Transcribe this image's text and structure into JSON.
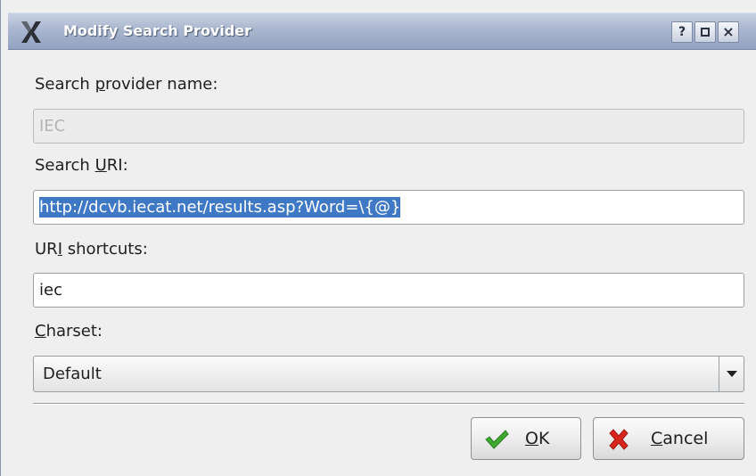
{
  "window": {
    "title": "Modify Search Provider",
    "titlebar_buttons": {
      "help": "?",
      "close": "×"
    }
  },
  "form": {
    "name": {
      "label_pre": "Search ",
      "label_mnemonic": "p",
      "label_post": "rovider name:",
      "value": "IEC",
      "disabled": true
    },
    "uri": {
      "label_pre": "Search ",
      "label_mnemonic": "U",
      "label_post": "RI:",
      "value": "http://dcvb.iecat.net/results.asp?Word=\\{@}",
      "selected": true
    },
    "shortcuts": {
      "label_pre": "UR",
      "label_mnemonic": "I",
      "label_post": " shortcuts:",
      "value": "iec"
    },
    "charset": {
      "label_pre": "",
      "label_mnemonic": "C",
      "label_post": "harset:",
      "selected": "Default"
    }
  },
  "buttons": {
    "ok": {
      "mnemonic": "O",
      "rest": "K",
      "icon": "check-icon"
    },
    "cancel": {
      "mnemonic": "C",
      "rest": "ancel",
      "icon": "x-icon"
    }
  },
  "colors": {
    "selection": "#3f79c6",
    "titlebar": "#a9b6cf",
    "ok_icon": "#3fa82f",
    "cancel_icon": "#d8261d"
  }
}
